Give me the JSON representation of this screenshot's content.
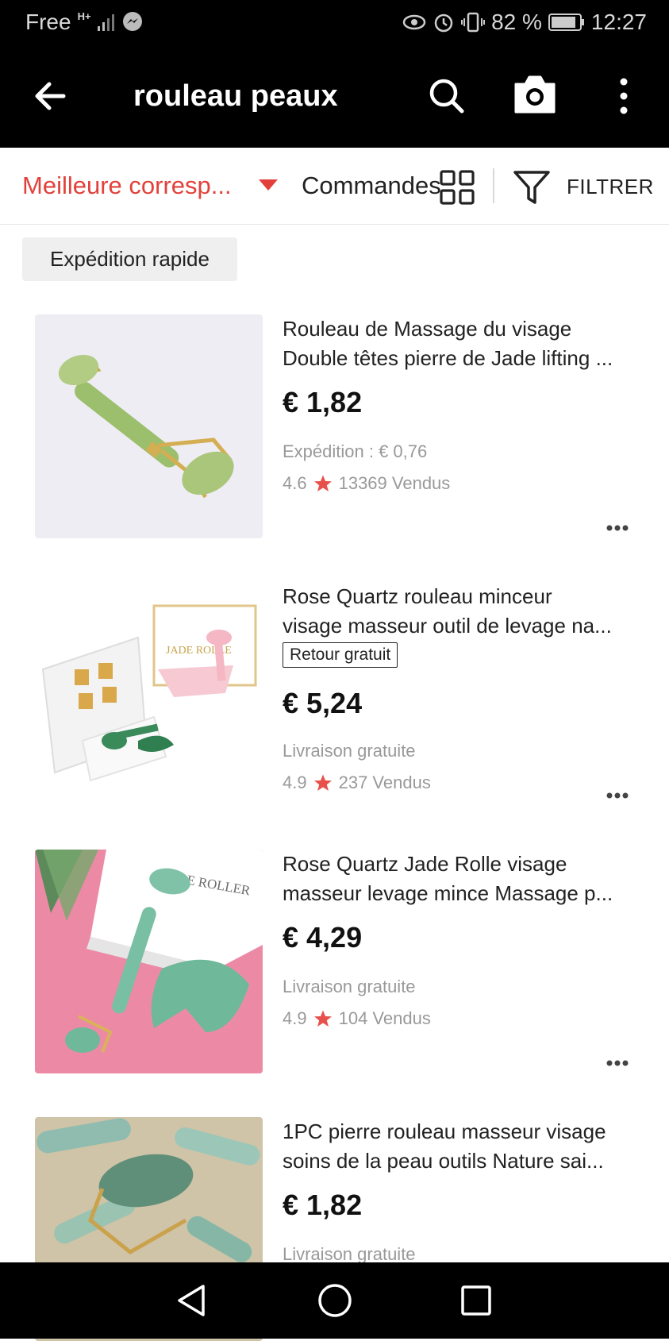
{
  "status_bar": {
    "carrier": "Free",
    "network": "H+",
    "battery": "82 %",
    "time": "12:27"
  },
  "toolbar": {
    "query": "rouleau peaux"
  },
  "sort_bar": {
    "best_match": "Meilleure corresp...",
    "orders": "Commandes",
    "filter": "FILTRER"
  },
  "chip": {
    "label": "Expédition rapide"
  },
  "products": [
    {
      "title_line1": "Rouleau de Massage du visage",
      "title_line2": "Double têtes pierre de Jade lifting ...",
      "price": "€ 1,82",
      "shipping": "Expédition : € 0,76",
      "rating": "4.6",
      "sold": "13369 Vendus"
    },
    {
      "title_line1": "Rose Quartz rouleau minceur",
      "title_line2": "visage masseur outil de levage na...",
      "badge": "Retour gratuit",
      "price": "€ 5,24",
      "shipping": "Livraison gratuite",
      "rating": "4.9",
      "sold": "237 Vendus",
      "image_text": "JADE ROLLE"
    },
    {
      "title_line1": "Rose Quartz Jade Rolle visage",
      "title_line2": "masseur levage mince Massage p...",
      "price": "€ 4,29",
      "shipping": "Livraison gratuite",
      "rating": "4.9",
      "sold": "104 Vendus",
      "image_text": "JADE ROLLER"
    },
    {
      "title_line1": "1PC pierre rouleau masseur visage",
      "title_line2": "soins de la peau outils Nature sai...",
      "price": "€ 1,82",
      "shipping": "Livraison gratuite"
    }
  ],
  "colors": {
    "accent": "#e2413b",
    "star": "#e8514b",
    "toolbar_bg": "#000000"
  },
  "icons": {
    "back": "arrow-left-icon",
    "search": "search-icon",
    "camera": "camera-icon",
    "more": "more-vertical-icon",
    "grid": "grid-view-icon",
    "filter": "filter-icon"
  }
}
